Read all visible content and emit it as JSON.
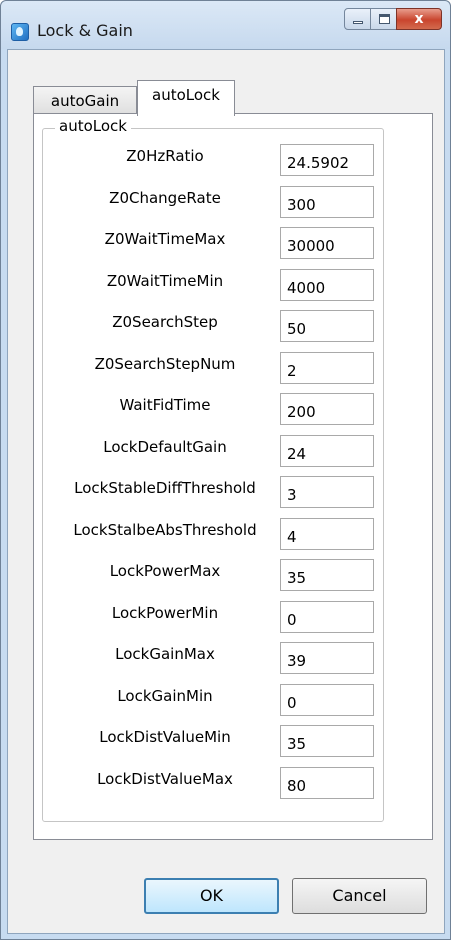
{
  "window": {
    "title": "Lock & Gain",
    "close_glyph": "x",
    "icons": {
      "app": "app-icon",
      "minimize": "minimize-icon",
      "maximize": "maximize-icon",
      "close": "close-icon"
    },
    "colors": {
      "accent": "#3c7fb1",
      "close_button": "#c9452e",
      "frame": "#c7dbf0"
    }
  },
  "tabs": [
    {
      "label": "autoGain",
      "selected": false
    },
    {
      "label": "autoLock",
      "selected": true
    }
  ],
  "group": {
    "title": "autoLock"
  },
  "params": [
    {
      "label": "Z0HzRatio",
      "value": "24.5902"
    },
    {
      "label": "Z0ChangeRate",
      "value": "300"
    },
    {
      "label": "Z0WaitTimeMax",
      "value": "30000"
    },
    {
      "label": "Z0WaitTimeMin",
      "value": "4000"
    },
    {
      "label": "Z0SearchStep",
      "value": "50"
    },
    {
      "label": "Z0SearchStepNum",
      "value": "2"
    },
    {
      "label": "WaitFidTime",
      "value": "200"
    },
    {
      "label": "LockDefaultGain",
      "value": "24"
    },
    {
      "label": "LockStableDiffThreshold",
      "value": "3"
    },
    {
      "label": "LockStalbeAbsThreshold",
      "value": "4"
    },
    {
      "label": "LockPowerMax",
      "value": "35"
    },
    {
      "label": "LockPowerMin",
      "value": "0"
    },
    {
      "label": "LockGainMax",
      "value": "39"
    },
    {
      "label": "LockGainMin",
      "value": "0"
    },
    {
      "label": "LockDistValueMin",
      "value": "35"
    },
    {
      "label": "LockDistValueMax",
      "value": "80"
    }
  ],
  "buttons": {
    "ok": "OK",
    "cancel": "Cancel"
  }
}
